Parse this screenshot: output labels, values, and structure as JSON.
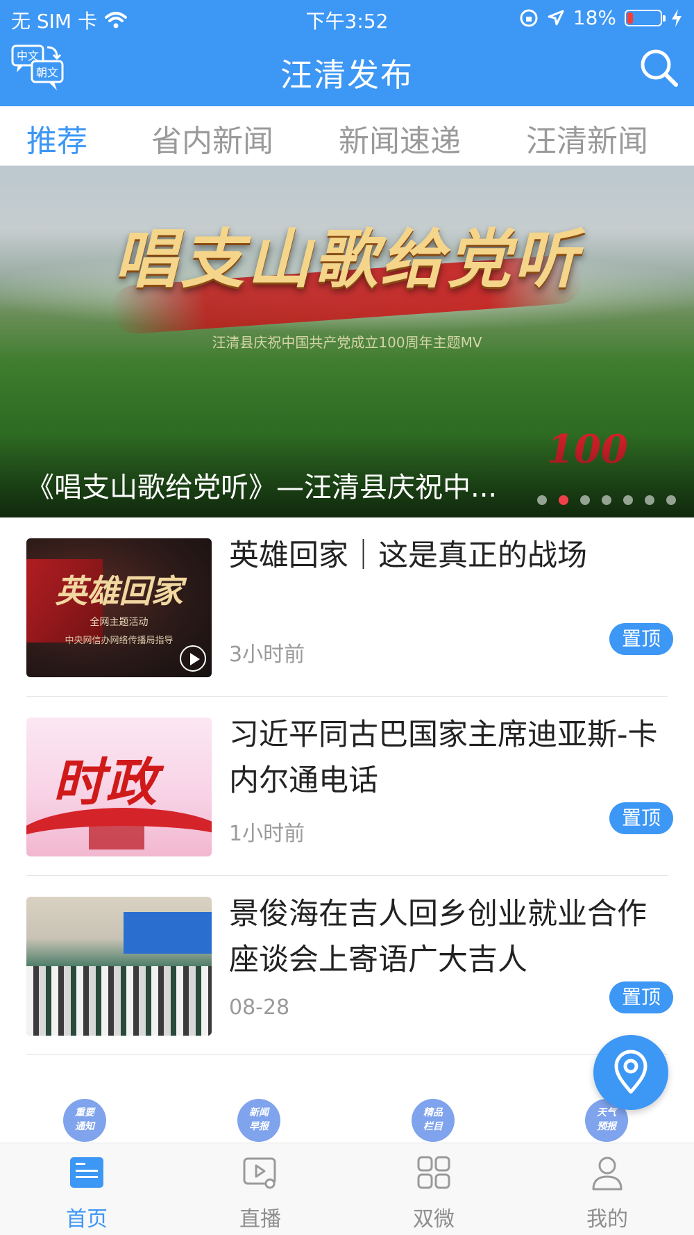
{
  "status": {
    "carrier": "无 SIM 卡",
    "time": "下午3:52",
    "battery": "18%",
    "battery_level": 0.18
  },
  "header": {
    "title": "汪清发布",
    "lang_icon_top": "中文",
    "lang_icon_bottom": "朝文"
  },
  "tabs": [
    {
      "label": "推荐",
      "active": true
    },
    {
      "label": "省内新闻",
      "active": false
    },
    {
      "label": "新闻速递",
      "active": false
    },
    {
      "label": "汪清新闻",
      "active": false
    }
  ],
  "banner": {
    "art_title": "唱支山歌给党听",
    "art_subtitle": "汪清县庆祝中国共产党成立100周年主题MV",
    "badge": "100",
    "caption": "《唱支山歌给党听》—汪清县庆祝中...",
    "dot_count": 7,
    "active_dot": 1
  },
  "news": [
    {
      "title": "英雄回家｜这是真正的战场",
      "time": "3小时前",
      "pin": "置顶",
      "thumb": {
        "title": "英雄回家",
        "line1": "全网主题活动",
        "line2": "中央网信办网络传播局指导"
      }
    },
    {
      "title": "习近平同古巴国家主席迪亚斯-卡内尔通电话",
      "time": "1小时前",
      "pin": "置顶",
      "thumb": {
        "title": "时政"
      }
    },
    {
      "title": "景俊海在吉人回乡创业就业合作座谈会上寄语广大吉人",
      "time": "08-28",
      "pin": "置顶",
      "thumb": {}
    }
  ],
  "quick_links": [
    {
      "label": "重要\n通知"
    },
    {
      "label": "新闻\n早报"
    },
    {
      "label": "精品\n栏目"
    },
    {
      "label": "天气\n预报"
    }
  ],
  "tabbar": [
    {
      "label": "首页",
      "icon": "news-icon",
      "active": true
    },
    {
      "label": "直播",
      "icon": "live-video-icon",
      "active": false
    },
    {
      "label": "双微",
      "icon": "grid-icon",
      "active": false
    },
    {
      "label": "我的",
      "icon": "person-icon",
      "active": false
    }
  ],
  "colors": {
    "accent": "#3d97f5",
    "active_dot": "#f0414a",
    "muted": "#9a9a9a"
  }
}
